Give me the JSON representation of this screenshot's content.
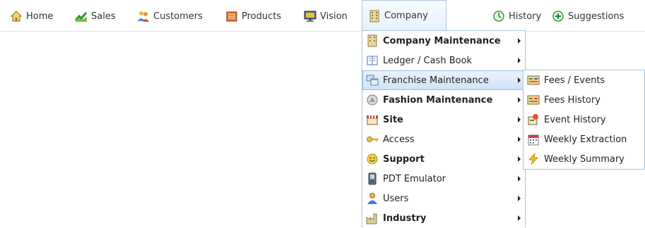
{
  "nav": {
    "home": "Home",
    "sales": "Sales",
    "customers": "Customers",
    "products": "Products",
    "vision": "Vision",
    "company": "Company",
    "history": "History",
    "suggestions": "Suggestions"
  },
  "company_menu": {
    "items": [
      {
        "label": "Company Maintenance",
        "bold": true
      },
      {
        "label": "Ledger / Cash Book",
        "bold": false
      },
      {
        "label": "Franchise Maintenance",
        "bold": false,
        "highlighted": true
      },
      {
        "label": "Fashion Maintenance",
        "bold": true
      },
      {
        "label": "Site",
        "bold": true
      },
      {
        "label": "Access",
        "bold": false
      },
      {
        "label": "Support",
        "bold": true
      },
      {
        "label": "PDT Emulator",
        "bold": false
      },
      {
        "label": "Users",
        "bold": false
      },
      {
        "label": "Industry",
        "bold": true
      }
    ]
  },
  "franchise_menu": {
    "items": [
      {
        "label": "Fees / Events"
      },
      {
        "label": "Fees History"
      },
      {
        "label": "Event History"
      },
      {
        "label": "Weekly Extraction"
      },
      {
        "label": "Weekly Summary"
      }
    ]
  },
  "colors": {
    "menu_border": "#a9c4de",
    "highlight": "#cfe3f7"
  }
}
